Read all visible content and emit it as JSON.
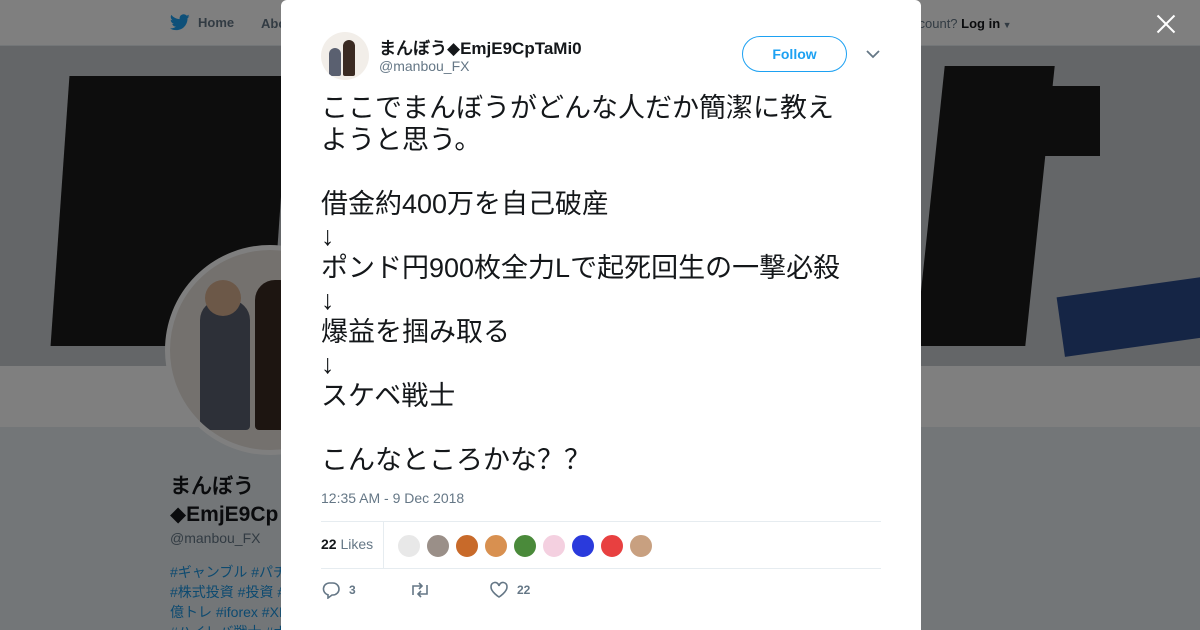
{
  "topnav": {
    "home_label": "Home",
    "about_label": "Abo",
    "login_prefix": "ccount? ",
    "login_label": "Log in"
  },
  "profile": {
    "name_line1": "まんぼう",
    "name_line2": "◆EmjE9Cp",
    "handle": "@manbou_FX",
    "tags": [
      "#ギャンブル #パチ",
      "#株式投資 #投資 #",
      "億トレ #iforex #XI",
      "#ハイレバ戦士 #ナ"
    ]
  },
  "tweet": {
    "user_name": "まんぼう◆EmjE9CpTaMi0",
    "user_handle": "@manbou_FX",
    "follow_label": "Follow",
    "text_lines": [
      "ここでまんぼうがどんな人だか簡潔に教え",
      "ようと思う。",
      "",
      "借金約400万を自己破産",
      "↓",
      "ポンド円900枚全力Lで起死回生の一撃必殺",
      "↓",
      "爆益を掴み取る",
      "↓",
      "スケベ戦士",
      "",
      "こんなところかな？？"
    ],
    "timestamp": "12:35 AM - 9 Dec 2018",
    "likes_count": "22",
    "likes_label": "Likes",
    "reply_count": "3",
    "retweet_count": "",
    "like_count": "22"
  },
  "liker_colors": [
    "#e8e8e8",
    "#9a8f88",
    "#c86a2a",
    "#d89050",
    "#4a8a3a",
    "#f4d0e0",
    "#2a3adc",
    "#e84040",
    "#c8a080"
  ],
  "colors": {
    "accent": "#1da1f2",
    "text": "#14171a",
    "muted": "#657786"
  }
}
